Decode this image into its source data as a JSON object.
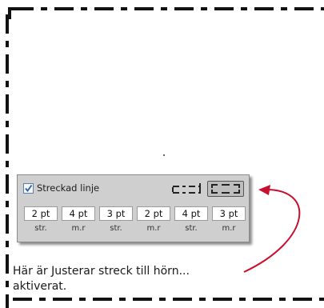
{
  "panel": {
    "checkbox_label": "Streckad linje",
    "checked": true,
    "fields": [
      {
        "value": "2 pt",
        "label": "str."
      },
      {
        "value": "4 pt",
        "label": "m.r"
      },
      {
        "value": "3 pt",
        "label": "str."
      },
      {
        "value": "2 pt",
        "label": "m.r"
      },
      {
        "value": "4 pt",
        "label": "str."
      },
      {
        "value": "3 pt",
        "label": "m.r"
      }
    ],
    "corner_options": [
      "dash-corner-icon",
      "dash-corner-adjusted-icon"
    ]
  },
  "callout": {
    "line1": "Här är Justerar streck till hörn...",
    "line2": "aktiverat."
  },
  "colors": {
    "dash": "#111111",
    "arrow": "#c8102e",
    "panel_bg": "#cfcfcf"
  }
}
